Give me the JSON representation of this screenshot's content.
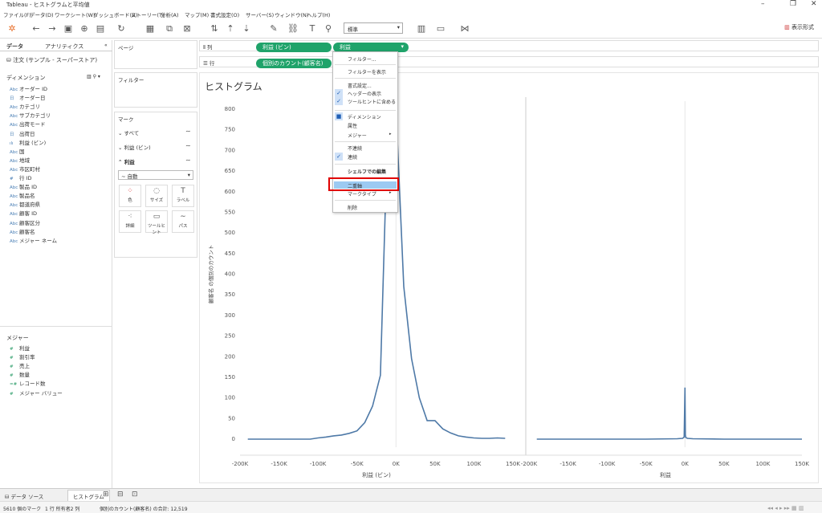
{
  "window": {
    "title": "Tableau - ヒストグラムと平均値"
  },
  "menu": [
    "ファイル(F)",
    "データ(D)",
    "ワークシート(W)",
    "ダッシュボード(B)",
    "ストーリー(T)",
    "分析(A)",
    "マップ(M)",
    "書式設定(O)",
    "サーバー(S)",
    "ウィンドウ(N)",
    "ヘルプ(H)"
  ],
  "toolbar": {
    "fit_select": "標準",
    "show_me": "表示形式"
  },
  "left": {
    "tab_data": "データ",
    "tab_analytics": "アナリティクス",
    "datasource": "注文 (サンプル - スーパーストア)",
    "dimensions_label": "ディメンション",
    "dimensions": [
      {
        "type": "Abc",
        "name": "オーダー ID"
      },
      {
        "type": "日",
        "name": "オーダー日"
      },
      {
        "type": "Abc",
        "name": "カテゴリ"
      },
      {
        "type": "Abc",
        "name": "サブカテゴリ"
      },
      {
        "type": "Abc",
        "name": "出荷モード"
      },
      {
        "type": "日",
        "name": "出荷日"
      },
      {
        "type": "ılı",
        "name": "利益 (ビン)"
      },
      {
        "type": "Abc",
        "name": "国"
      },
      {
        "type": "Abc",
        "name": "地域"
      },
      {
        "type": "Abc",
        "name": "市区町村"
      },
      {
        "type": "#",
        "name": "行 ID"
      },
      {
        "type": "Abc",
        "name": "製品 ID"
      },
      {
        "type": "Abc",
        "name": "製品名"
      },
      {
        "type": "Abc",
        "name": "都道府県"
      },
      {
        "type": "Abc",
        "name": "顧客 ID"
      },
      {
        "type": "Abc",
        "name": "顧客区分"
      },
      {
        "type": "Abc",
        "name": "顧客名"
      },
      {
        "type": "Abc",
        "name": "メジャー ネーム"
      }
    ],
    "measures_label": "メジャー",
    "measures": [
      {
        "type": "#",
        "name": "利益"
      },
      {
        "type": "#",
        "name": "割引率"
      },
      {
        "type": "#",
        "name": "売上"
      },
      {
        "type": "#",
        "name": "数量"
      },
      {
        "type": "=#",
        "name": "レコード数"
      },
      {
        "type": "#",
        "name": "メジャー バリュー"
      }
    ]
  },
  "cards": {
    "pages": "ページ",
    "filters": "フィルター",
    "marks": "マーク",
    "marks_all": "すべて",
    "marks_bin": "利益 (ビン)",
    "marks_profit": "利益",
    "mark_type": "自動",
    "mark_buttons": [
      "色",
      "サイズ",
      "ラベル",
      "詳細",
      "ツールヒント",
      "パス"
    ]
  },
  "shelves": {
    "columns_label": "列",
    "rows_label": "行",
    "col_pill_1": "利益 (ビン)",
    "col_pill_2": "利益",
    "row_pill": "個別のカウント(顧客名)"
  },
  "context_menu": [
    {
      "label": "フィルター...",
      "checked": false
    },
    {
      "label": "フィルターを表示",
      "checked": false
    },
    {
      "label": "書式設定...",
      "checked": false
    },
    {
      "label": "ヘッダーの表示",
      "checked": true
    },
    {
      "label": "ツールヒントに含める",
      "checked": true
    },
    {
      "label": "ディメンション",
      "checked": true
    },
    {
      "label": "属性",
      "checked": false
    },
    {
      "label": "メジャー",
      "checked": false
    },
    {
      "label": "不連続",
      "checked": false
    },
    {
      "label": "連続",
      "checked": true
    },
    {
      "label": "シェルフでの編集",
      "checked": false
    },
    {
      "label": "二重軸",
      "checked": false
    },
    {
      "label": "マークタイプ",
      "checked": false
    },
    {
      "label": "削除",
      "checked": false
    }
  ],
  "chart_data": {
    "type": "line",
    "title": "ヒストグラム",
    "ylabel": "顧客名 の個別のカウント",
    "ylim": [
      0,
      800
    ],
    "yticks": [
      0,
      50,
      100,
      150,
      200,
      250,
      300,
      350,
      400,
      450,
      500,
      550,
      600,
      650,
      700,
      750,
      800
    ],
    "panels": [
      {
        "xlabel": "利益 (ビン)",
        "xlim": [
          -200000,
          150000
        ],
        "xticks": [
          "-200K",
          "-150K",
          "-100K",
          "-50K",
          "0K",
          "50K",
          "100K",
          "150K"
        ],
        "xtick_values": [
          -200000,
          -150000,
          -100000,
          -50000,
          0,
          50000,
          100000,
          150000
        ],
        "x": [
          -190000,
          -170000,
          -150000,
          -130000,
          -110000,
          -100000,
          -90000,
          -80000,
          -70000,
          -60000,
          -50000,
          -40000,
          -30000,
          -20000,
          -10000,
          0,
          10000,
          20000,
          30000,
          40000,
          50000,
          60000,
          70000,
          80000,
          90000,
          100000,
          110000,
          120000,
          130000,
          140000
        ],
        "y": [
          0,
          0,
          0,
          0,
          0,
          3,
          5,
          8,
          10,
          14,
          20,
          40,
          80,
          155,
          800,
          800,
          370,
          195,
          100,
          45,
          45,
          25,
          15,
          8,
          5,
          3,
          2,
          2,
          3,
          2
        ]
      },
      {
        "xlabel": "利益",
        "xlim": [
          -200000,
          150000
        ],
        "xticks": [
          "-200K",
          "-150K",
          "-100K",
          "-50K",
          "0K",
          "50K",
          "100K",
          "150K"
        ],
        "xtick_values": [
          -200000,
          -150000,
          -100000,
          -50000,
          0,
          50000,
          100000,
          150000
        ],
        "x": [
          -190000,
          -150000,
          -100000,
          -50000,
          -10000,
          -3000,
          -1000,
          0,
          500,
          1000,
          3000,
          10000,
          50000,
          100000,
          150000
        ],
        "y": [
          0,
          0,
          0,
          0,
          1,
          2,
          5,
          125,
          10,
          4,
          2,
          1,
          0,
          0,
          0
        ]
      }
    ]
  },
  "bottom": {
    "datasource_tab": "データ ソース",
    "sheet_tab": "ヒストグラム"
  },
  "status": {
    "marks": "5610 個のマーク",
    "rowscols": "1 行 所有者2 列",
    "sum": "個別のカウント(顧客名) の合計: 12,519"
  }
}
